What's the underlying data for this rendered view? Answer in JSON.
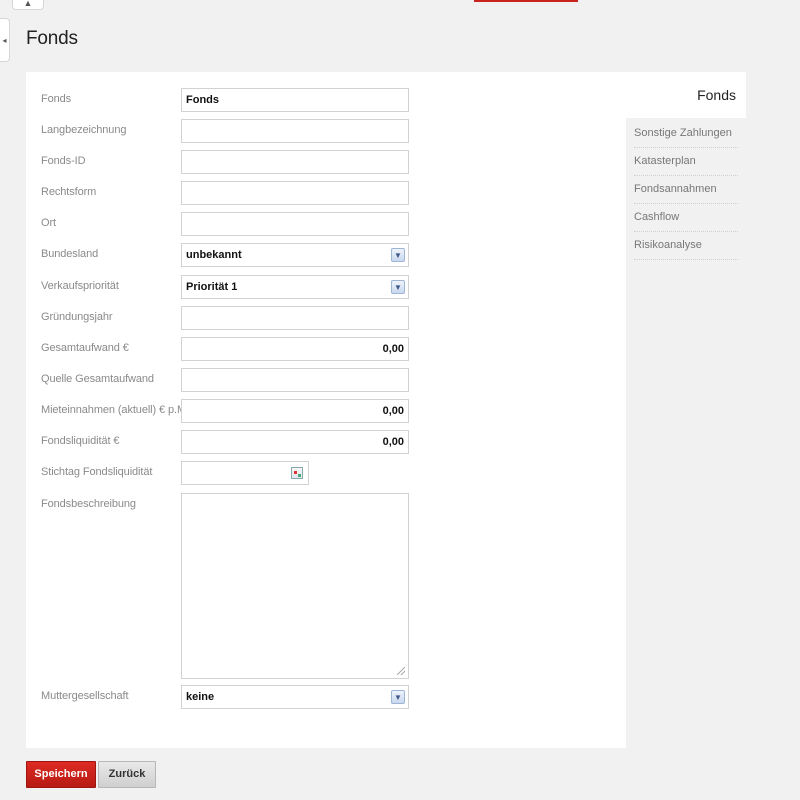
{
  "top_tab_glyph": "▲",
  "side_handle_glyph": "◂",
  "page_title": "Fonds",
  "form": {
    "fonds": {
      "label": "Fonds",
      "value": "Fonds"
    },
    "langbezeichnung": {
      "label": "Langbezeichnung",
      "value": ""
    },
    "fonds_id": {
      "label": "Fonds-ID",
      "value": ""
    },
    "rechtsform": {
      "label": "Rechtsform",
      "value": ""
    },
    "ort": {
      "label": "Ort",
      "value": ""
    },
    "bundesland": {
      "label": "Bundesland",
      "value": "unbekannt"
    },
    "verkaufsprioritaet": {
      "label": "Verkaufspriorität",
      "value": "Priorität 1"
    },
    "gruendungsjahr": {
      "label": "Gründungsjahr",
      "value": ""
    },
    "gesamtaufwand": {
      "label": "Gesamtaufwand €",
      "value": "0,00"
    },
    "quelle_gesamtaufwand": {
      "label": "Quelle Gesamtaufwand",
      "value": ""
    },
    "mieteinnahmen": {
      "label": "Mieteinnahmen (aktuell) € p.M.",
      "value": "0,00"
    },
    "fondsliquiditaet": {
      "label": "Fondsliquidität €",
      "value": "0,00"
    },
    "stichtag_fondsliquiditaet": {
      "label": "Stichtag Fondsliquidität",
      "value": ""
    },
    "fondsbeschreibung": {
      "label": "Fondsbeschreibung",
      "value": ""
    },
    "muttergesellschaft": {
      "label": "Muttergesellschaft",
      "value": "keine"
    }
  },
  "select_arrow_glyph": "▼",
  "sidenav": {
    "active": "Fonds",
    "items": [
      "Sonstige Zahlungen",
      "Katasterplan",
      "Fondsannahmen",
      "Cashflow",
      "Risikoanalyse"
    ]
  },
  "buttons": {
    "save": "Speichern",
    "back": "Zurück"
  },
  "colors": {
    "accent": "#c8231c",
    "background": "#f1f1f1",
    "panel": "#ffffff"
  },
  "icons": {
    "calendar": "calendar-icon",
    "dropdown": "chevron-down-icon",
    "resize": "resize-grip-icon"
  }
}
